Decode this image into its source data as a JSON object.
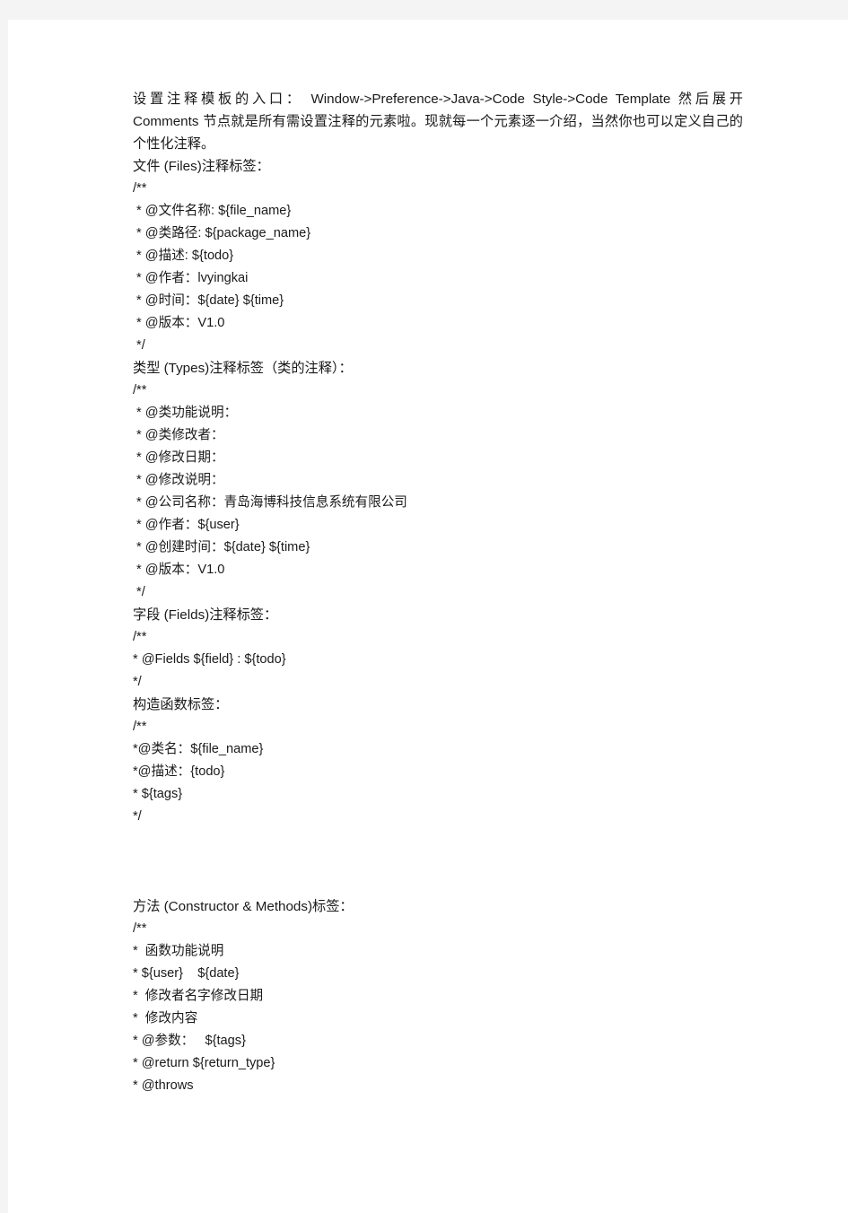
{
  "document": {
    "background_color": "#f4f4f4",
    "page_color": "#ffffff",
    "text_color": "#1a1a1a",
    "intro_paragraph": "设置注释模板的入口：  Window->Preference->Java->Code  Style->Code  Template  然后展开Comments 节点就是所有需设置注释的元素啦。现就每一个元素逐一介绍，当然你也可以定义自己的个性化注释。",
    "sections": [
      {
        "heading": "文件 (Files)注释标签：",
        "lines": [
          "/**",
          " * @文件名称: ${file_name}",
          " * @类路径: ${package_name}",
          " * @描述: ${todo}",
          " * @作者：lvyingkai",
          " * @时间：${date} ${time}",
          " * @版本：V1.0",
          " */"
        ]
      },
      {
        "heading": "类型 (Types)注释标签（类的注释）：",
        "lines": [
          "/**",
          " * @类功能说明：",
          " * @类修改者：",
          " * @修改日期：",
          " * @修改说明：",
          " * @公司名称：青岛海博科技信息系统有限公司",
          " * @作者：${user}",
          " * @创建时间：${date} ${time}",
          " * @版本：V1.0",
          " */"
        ]
      },
      {
        "heading": "字段 (Fields)注释标签：",
        "lines": [
          "/**",
          "* @Fields ${field} : ${todo}",
          "*/"
        ]
      },
      {
        "heading": "构造函数标签：",
        "lines": [
          "/**",
          "*@类名：${file_name}",
          "*@描述：{todo}",
          "* ${tags}",
          "*/"
        ]
      },
      {
        "heading": "方法 (Constructor & Methods)标签：",
        "lines": [
          "/**",
          "*  函数功能说明",
          "* ${user}    ${date}",
          "*  修改者名字修改日期",
          "*  修改内容",
          "* @参数：   ${tags}",
          "* @return ${return_type}",
          "* @throws"
        ]
      }
    ]
  }
}
